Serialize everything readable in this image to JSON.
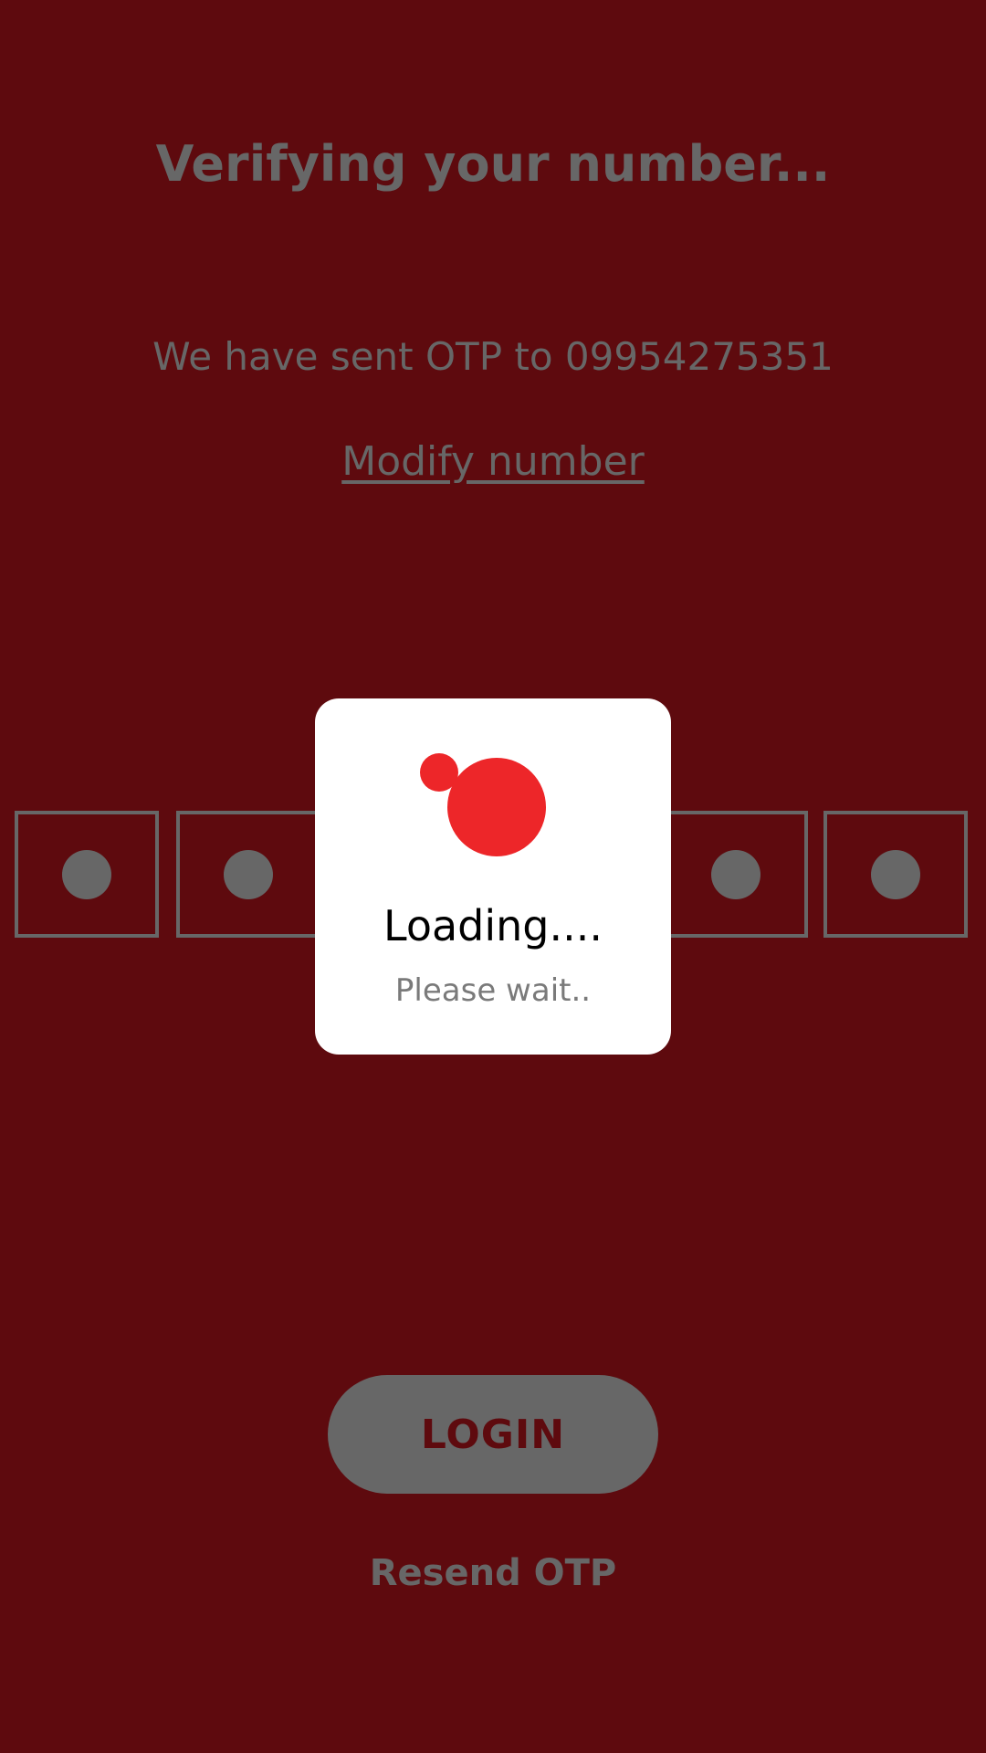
{
  "header": {
    "title": "Verifying your number..."
  },
  "otp_info": {
    "sent_text": "We have sent OTP to 09954275351",
    "modify_label": "Modify number"
  },
  "otp_input": {
    "digit_count": 6,
    "visible_boxes": 4
  },
  "actions": {
    "login_label": "LOGIN",
    "resend_label": "Resend OTP"
  },
  "loading_dialog": {
    "title": "Loading....",
    "subtitle": "Please wait.."
  },
  "colors": {
    "background": "#5e0a0e",
    "muted": "#676767",
    "accent": "#ed2629",
    "dialog": "#ffffff"
  }
}
